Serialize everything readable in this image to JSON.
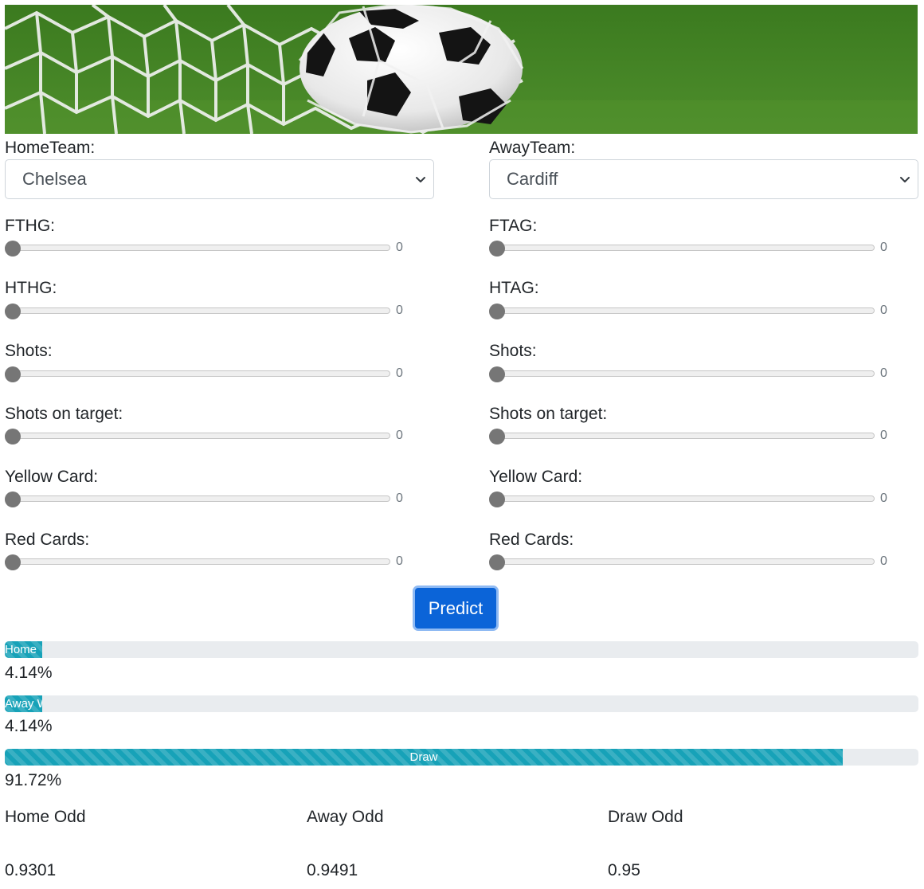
{
  "home": {
    "team_label": "HomeTeam:",
    "team_value": "Chelsea",
    "sliders": [
      {
        "label": "FTHG:",
        "value": "0",
        "level": 0
      },
      {
        "label": "HTHG:",
        "value": "0",
        "level": 0
      },
      {
        "label": "Shots:",
        "value": "0",
        "level": 0
      },
      {
        "label": "Shots on target:",
        "value": "0",
        "level": 0
      },
      {
        "label": "Yellow Card:",
        "value": "0",
        "level": 0
      },
      {
        "label": "Red Cards:",
        "value": "0",
        "level": 0
      }
    ]
  },
  "away": {
    "team_label": "AwayTeam:",
    "team_value": "Cardiff",
    "sliders": [
      {
        "label": "FTAG:",
        "value": "0",
        "level": 0
      },
      {
        "label": "HTAG:",
        "value": "0",
        "level": 0
      },
      {
        "label": "Shots:",
        "value": "0",
        "level": 0
      },
      {
        "label": "Shots on target:",
        "value": "0",
        "level": 0
      },
      {
        "label": "Yellow Card:",
        "value": "0",
        "level": 0
      },
      {
        "label": "Red Cards:",
        "value": "0",
        "level": 0
      }
    ]
  },
  "predict_label": "Predict",
  "results": [
    {
      "label": "Home",
      "percent_text": "4.14%",
      "fraction": 0.0414
    },
    {
      "label": "Away W",
      "percent_text": "4.14%",
      "fraction": 0.0414
    },
    {
      "label": "Draw",
      "percent_text": "91.72%",
      "fraction": 0.9172
    }
  ],
  "odds": [
    {
      "label": "Home Odd",
      "value": "0.9301"
    },
    {
      "label": "Away Odd",
      "value": "0.9491"
    },
    {
      "label": "Draw Odd",
      "value": "0.95"
    }
  ],
  "colors": {
    "accent": "#0b64d8",
    "progress_bar": "#17a2b8",
    "progress_track": "#e9ecef",
    "slider_thumb": "#767676"
  }
}
